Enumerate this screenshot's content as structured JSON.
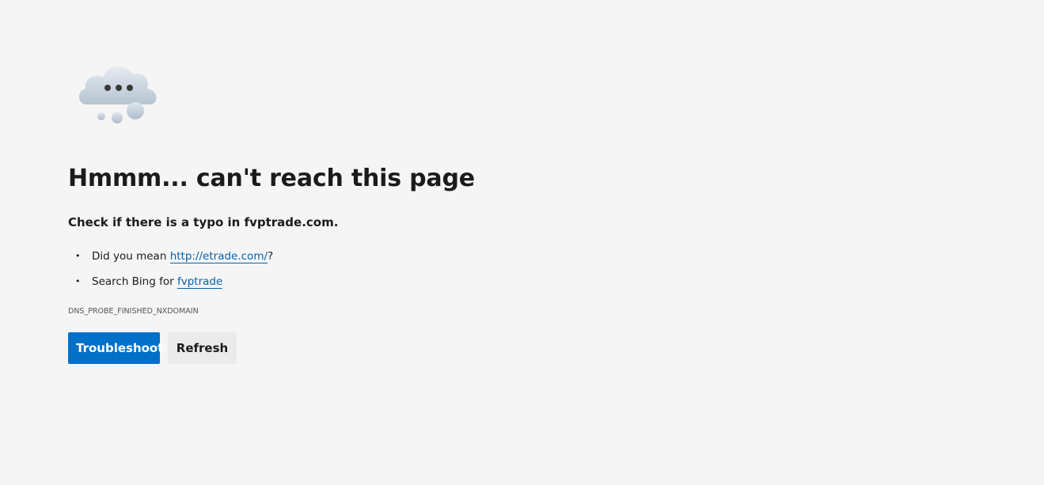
{
  "illustration": {
    "icon": "thinking-cloud-icon",
    "colors": {
      "cloud": "#c9d3de",
      "dots": "#3a3a3a"
    }
  },
  "error": {
    "title": "Hmmm... can't reach this page",
    "subtitle": "Check if there is a typo in fvptrade.com.",
    "code": "DNS_PROBE_FINISHED_NXDOMAIN"
  },
  "suggestions": [
    {
      "prefix": "Did you mean ",
      "link_text": "http://etrade.com/",
      "suffix": "?"
    },
    {
      "prefix": "Search Bing for ",
      "link_text": "fvptrade",
      "suffix": ""
    }
  ],
  "buttons": {
    "troubleshoot": "Troubleshoot",
    "refresh": "Refresh"
  },
  "colors": {
    "background": "#f5f5f5",
    "accent": "#0070c9",
    "link": "#0063b1"
  }
}
